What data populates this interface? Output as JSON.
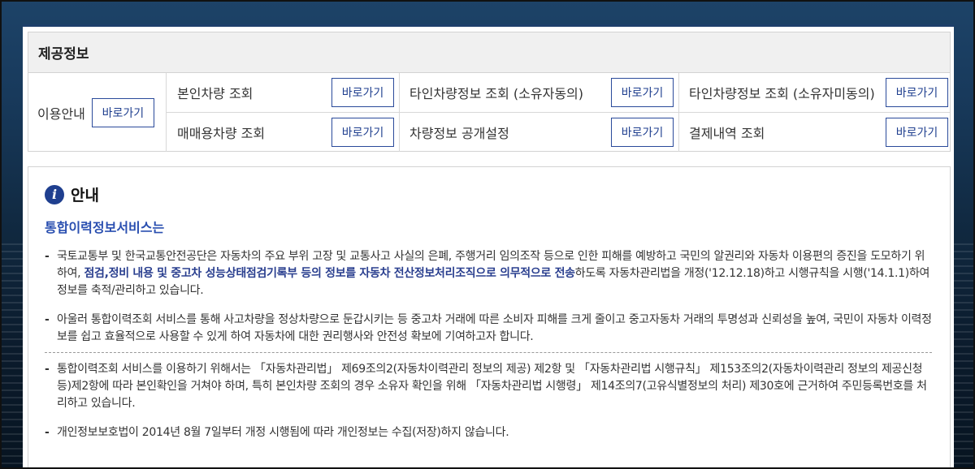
{
  "section_title": "제공정보",
  "usage": {
    "label": "이용안내",
    "button": "바로가기"
  },
  "services": [
    {
      "label": "본인차량 조회",
      "button": "바로가기"
    },
    {
      "label": "타인차량정보 조회 (소유자동의)",
      "button": "바로가기"
    },
    {
      "label": "타인차량정보 조회 (소유자미동의)",
      "button": "바로가기"
    },
    {
      "label": "매매용차량 조회",
      "button": "바로가기"
    },
    {
      "label": "차량정보 공개설정",
      "button": "바로가기"
    },
    {
      "label": "결제내역 조회",
      "button": "바로가기"
    }
  ],
  "notice": {
    "title": "안내",
    "subtitle": "통합이력정보서비스는",
    "bullet": "-",
    "p1_pre": "국토교통부 및 한국교통안전공단은 자동차의 주요 부위 고장 및 교통사고 사실의 은폐, 주행거리 임의조작 등으로 인한 피해를 예방하고 국민의 알권리와 자동차 이용편의 증진을 도모하기 위하여, ",
    "p1_bold": "점검,정비 내용 및 중고차 성능상태점검기록부 등의 정보를 자동차 전산정보처리조직으로 의무적으로 전송",
    "p1_post": "하도록 자동차관리법을 개정('12.12.18)하고 시행규칙을 시행('14.1.1)하여 정보를 축적/관리하고 있습니다.",
    "p2": "아울러 통합이력조회 서비스를 통해 사고차량을 정상차량으로 둔갑시키는 등 중고차 거래에 따른 소비자 피해를 크게 줄이고 중고자동차 거래의 투명성과 신뢰성을 높여, 국민이 자동차 이력정보를 쉽고 효율적으로 사용할 수 있게 하여 자동차에 대한 권리행사와 안전성 확보에 기여하고자 합니다.",
    "p3": "통합이력조회 서비스를 이용하기 위해서는 「자동차관리법」 제69조의2(자동차이력관리 정보의 제공) 제2항 및 「자동차관리법 시행규칙」 제153조의2(자동차이력관리 정보의 제공신청 등)제2항에 따라 본인확인을 거쳐야 하며, 특히 본인차량 조회의 경우 소유자 확인을 위해 「자동차관리법 시행령」 제14조의7(고유식별정보의 처리) 제30호에 근거하여 주민등록번호를 처리하고 있습니다.",
    "p4": "개인정보보호법이 2014년 8월 7일부터 개정 시행됨에 따라 개인정보는 수집(저장)하지 않습니다."
  }
}
